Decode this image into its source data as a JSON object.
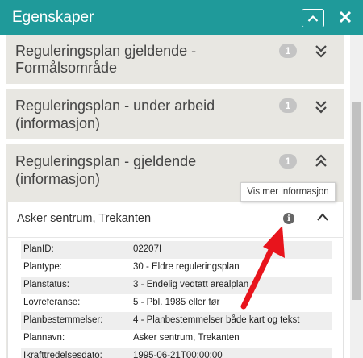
{
  "header": {
    "title": "Egenskaper"
  },
  "sections": [
    {
      "title_line1": "Reguleringsplan gjeldende -",
      "title_line2": "Formålsområde",
      "badge": "1"
    },
    {
      "title_line1": "Reguleringsplan - under arbeid",
      "title_line2": "(informasjon)",
      "badge": "1"
    },
    {
      "title_line1": "Reguleringsplan - gjeldende",
      "title_line2": "(informasjon)",
      "badge": "1"
    }
  ],
  "tooltip": "Vis mer informasjon",
  "feature": {
    "title": "Asker sentrum, Trekanten",
    "info_icon": "i",
    "properties": [
      {
        "key": "PlanID:",
        "value": "02207I"
      },
      {
        "key": "Plantype:",
        "value": "30 - Eldre reguleringsplan"
      },
      {
        "key": "Planstatus:",
        "value": "3 - Endelig vedtatt arealplan"
      },
      {
        "key": "Lovreferanse:",
        "value": "5 - Pbl. 1985 eller før"
      },
      {
        "key": "Planbestemmelser:",
        "value": "4 - Planbestemmelser både kart og tekst"
      },
      {
        "key": "Plannavn:",
        "value": "Asker sentrum, Trekanten"
      },
      {
        "key": "Ikrafttredelsesdato:",
        "value": "1995-06-21T00:00:00"
      }
    ]
  },
  "colors": {
    "header": "#1f9a9a",
    "section_bg": "#e8e7e2",
    "arrow": "#e8141c"
  }
}
